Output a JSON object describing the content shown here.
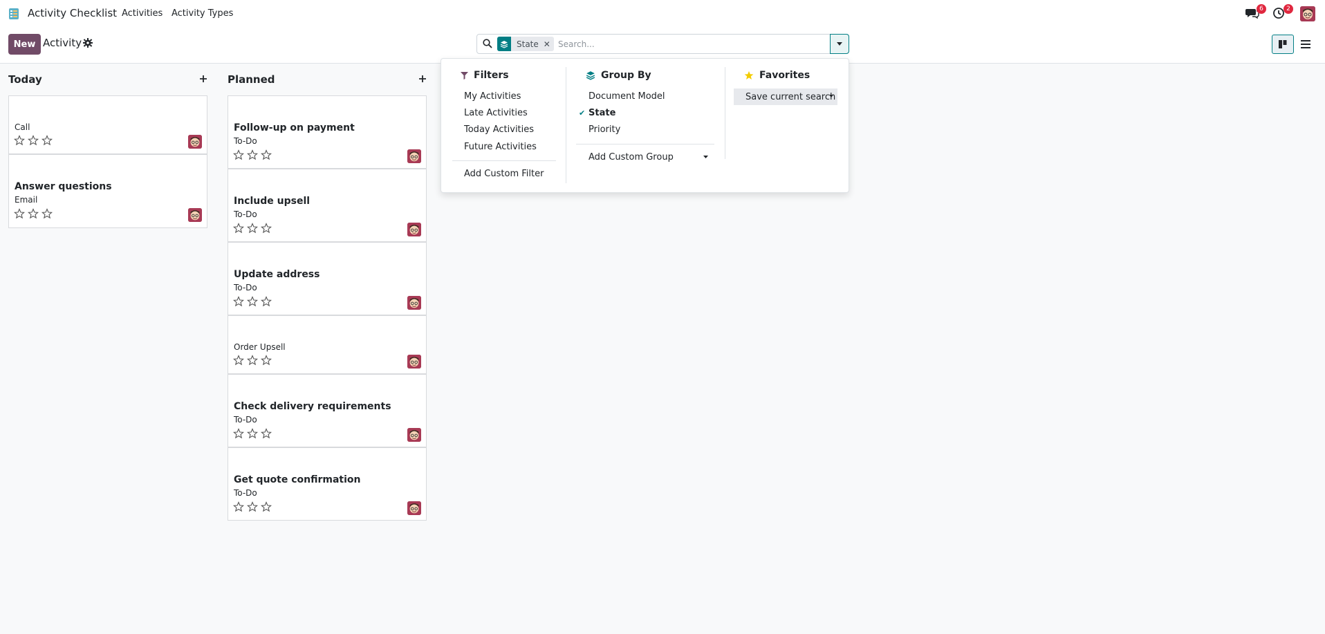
{
  "app": {
    "title": "Activity Checklist"
  },
  "nav": {
    "items": [
      "Activities",
      "Activity Types"
    ]
  },
  "notifications": {
    "messages_count": "6",
    "activities_count": "2"
  },
  "control": {
    "new_label": "New",
    "breadcrumb": "Activity",
    "search": {
      "facet_label": "State",
      "placeholder": "Search..."
    }
  },
  "dropdown": {
    "filters": {
      "title": "Filters",
      "items": [
        "My Activities",
        "Late Activities",
        "Today Activities",
        "Future Activities"
      ],
      "custom": "Add Custom Filter"
    },
    "group_by": {
      "title": "Group By",
      "items": [
        "Document Model",
        "State",
        "Priority"
      ],
      "selected": "State",
      "custom": "Add Custom Group"
    },
    "favorites": {
      "title": "Favorites",
      "save_label": "Save current search"
    }
  },
  "columns": [
    {
      "title": "Today",
      "cards": [
        {
          "title": "",
          "subtitle": "Call",
          "stars": 0
        },
        {
          "title": "Answer questions",
          "subtitle": "Email",
          "stars": 0
        }
      ]
    },
    {
      "title": "Planned",
      "cards": [
        {
          "title": "Follow-up on payment",
          "subtitle": "To-Do",
          "stars": 0
        },
        {
          "title": "Include upsell",
          "subtitle": "To-Do",
          "stars": 0
        },
        {
          "title": "Update address",
          "subtitle": "To-Do",
          "stars": 0
        },
        {
          "title": "",
          "subtitle": "Order Upsell",
          "stars": 0
        },
        {
          "title": "Check delivery requirements",
          "subtitle": "To-Do",
          "stars": 0
        },
        {
          "title": "Get quote confirmation",
          "subtitle": "To-Do",
          "stars": 0
        }
      ]
    }
  ],
  "colors": {
    "primary": "#714b67",
    "accent": "#017e84",
    "badge": "#e0283f"
  }
}
